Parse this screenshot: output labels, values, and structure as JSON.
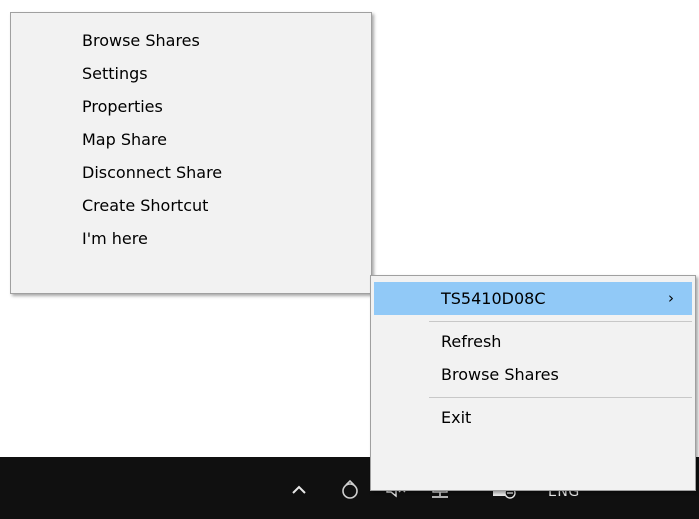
{
  "submenu": {
    "items": [
      {
        "label": "Browse Shares"
      },
      {
        "label": "Settings"
      },
      {
        "label": "Properties"
      },
      {
        "label": "Map Share"
      },
      {
        "label": "Disconnect Share"
      },
      {
        "label": "Create Shortcut"
      },
      {
        "label": "I'm here"
      }
    ]
  },
  "context_menu": {
    "device_item": {
      "label": "TS5410D08C",
      "arrow": "›"
    },
    "refresh_label": "Refresh",
    "browse_label": "Browse Shares",
    "exit_label": "Exit"
  },
  "taskbar": {
    "icons": [
      "chevron-up-icon",
      "network-agent-icon",
      "speaker-muted-icon",
      "network-icon",
      "notification-icon"
    ],
    "language": "ENG"
  },
  "colors": {
    "menu_background": "#f2f2f2",
    "highlight": "#91c9f7",
    "taskbar": "#101010"
  }
}
